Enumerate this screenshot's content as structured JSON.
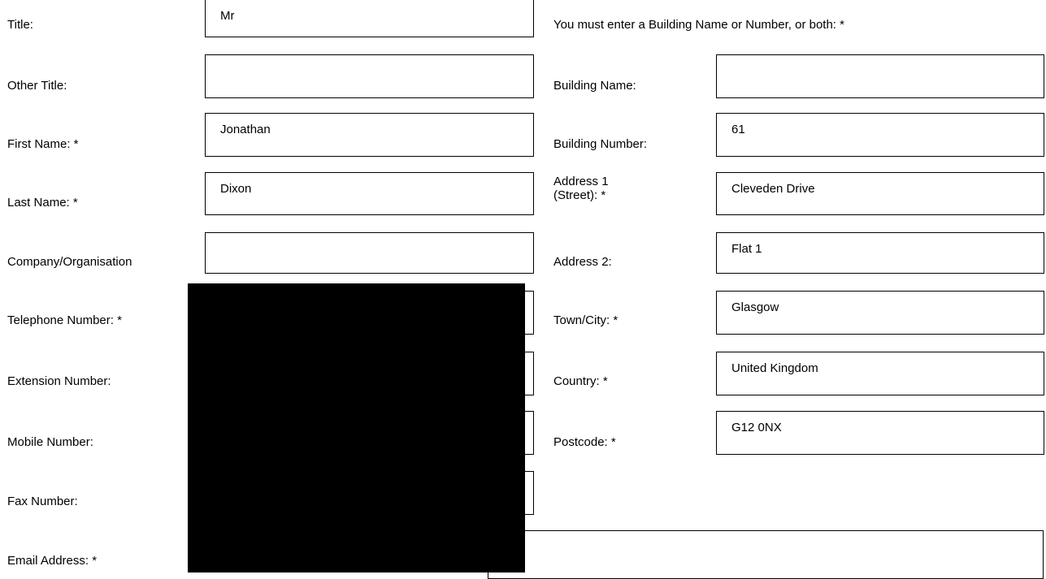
{
  "left_form": {
    "title": {
      "label": "Title:",
      "value": "Mr"
    },
    "other_title": {
      "label": "Other Title:",
      "value": ""
    },
    "first_name": {
      "label": "First Name: *",
      "value": "Jonathan"
    },
    "last_name": {
      "label": "Last Name: *",
      "value": "Dixon"
    },
    "company": {
      "label": "Company/Organisation",
      "value": ""
    },
    "telephone": {
      "label": "Telephone Number: *"
    },
    "extension": {
      "label": "Extension Number:"
    },
    "mobile": {
      "label": "Mobile Number:"
    },
    "fax": {
      "label": "Fax Number:"
    },
    "email": {
      "label": "Email Address: *"
    }
  },
  "right_form": {
    "instruction": "You must enter a Building Name or Number, or both: *",
    "building_name": {
      "label": "Building Name:",
      "value": ""
    },
    "building_number": {
      "label": "Building Number:",
      "value": "61"
    },
    "address1": {
      "label_line1": "Address 1",
      "label_line2": "(Street): *",
      "value": "Cleveden Drive"
    },
    "address2": {
      "label": "Address 2:",
      "value": "Flat 1"
    },
    "town": {
      "label": "Town/City: *",
      "value": "Glasgow"
    },
    "country": {
      "label": "Country: *",
      "value": "United Kingdom"
    },
    "postcode": {
      "label": "Postcode: *",
      "value": "G12 0NX"
    }
  },
  "colors": {
    "redaction": "#000000",
    "border": "#000000",
    "background": "#ffffff"
  }
}
